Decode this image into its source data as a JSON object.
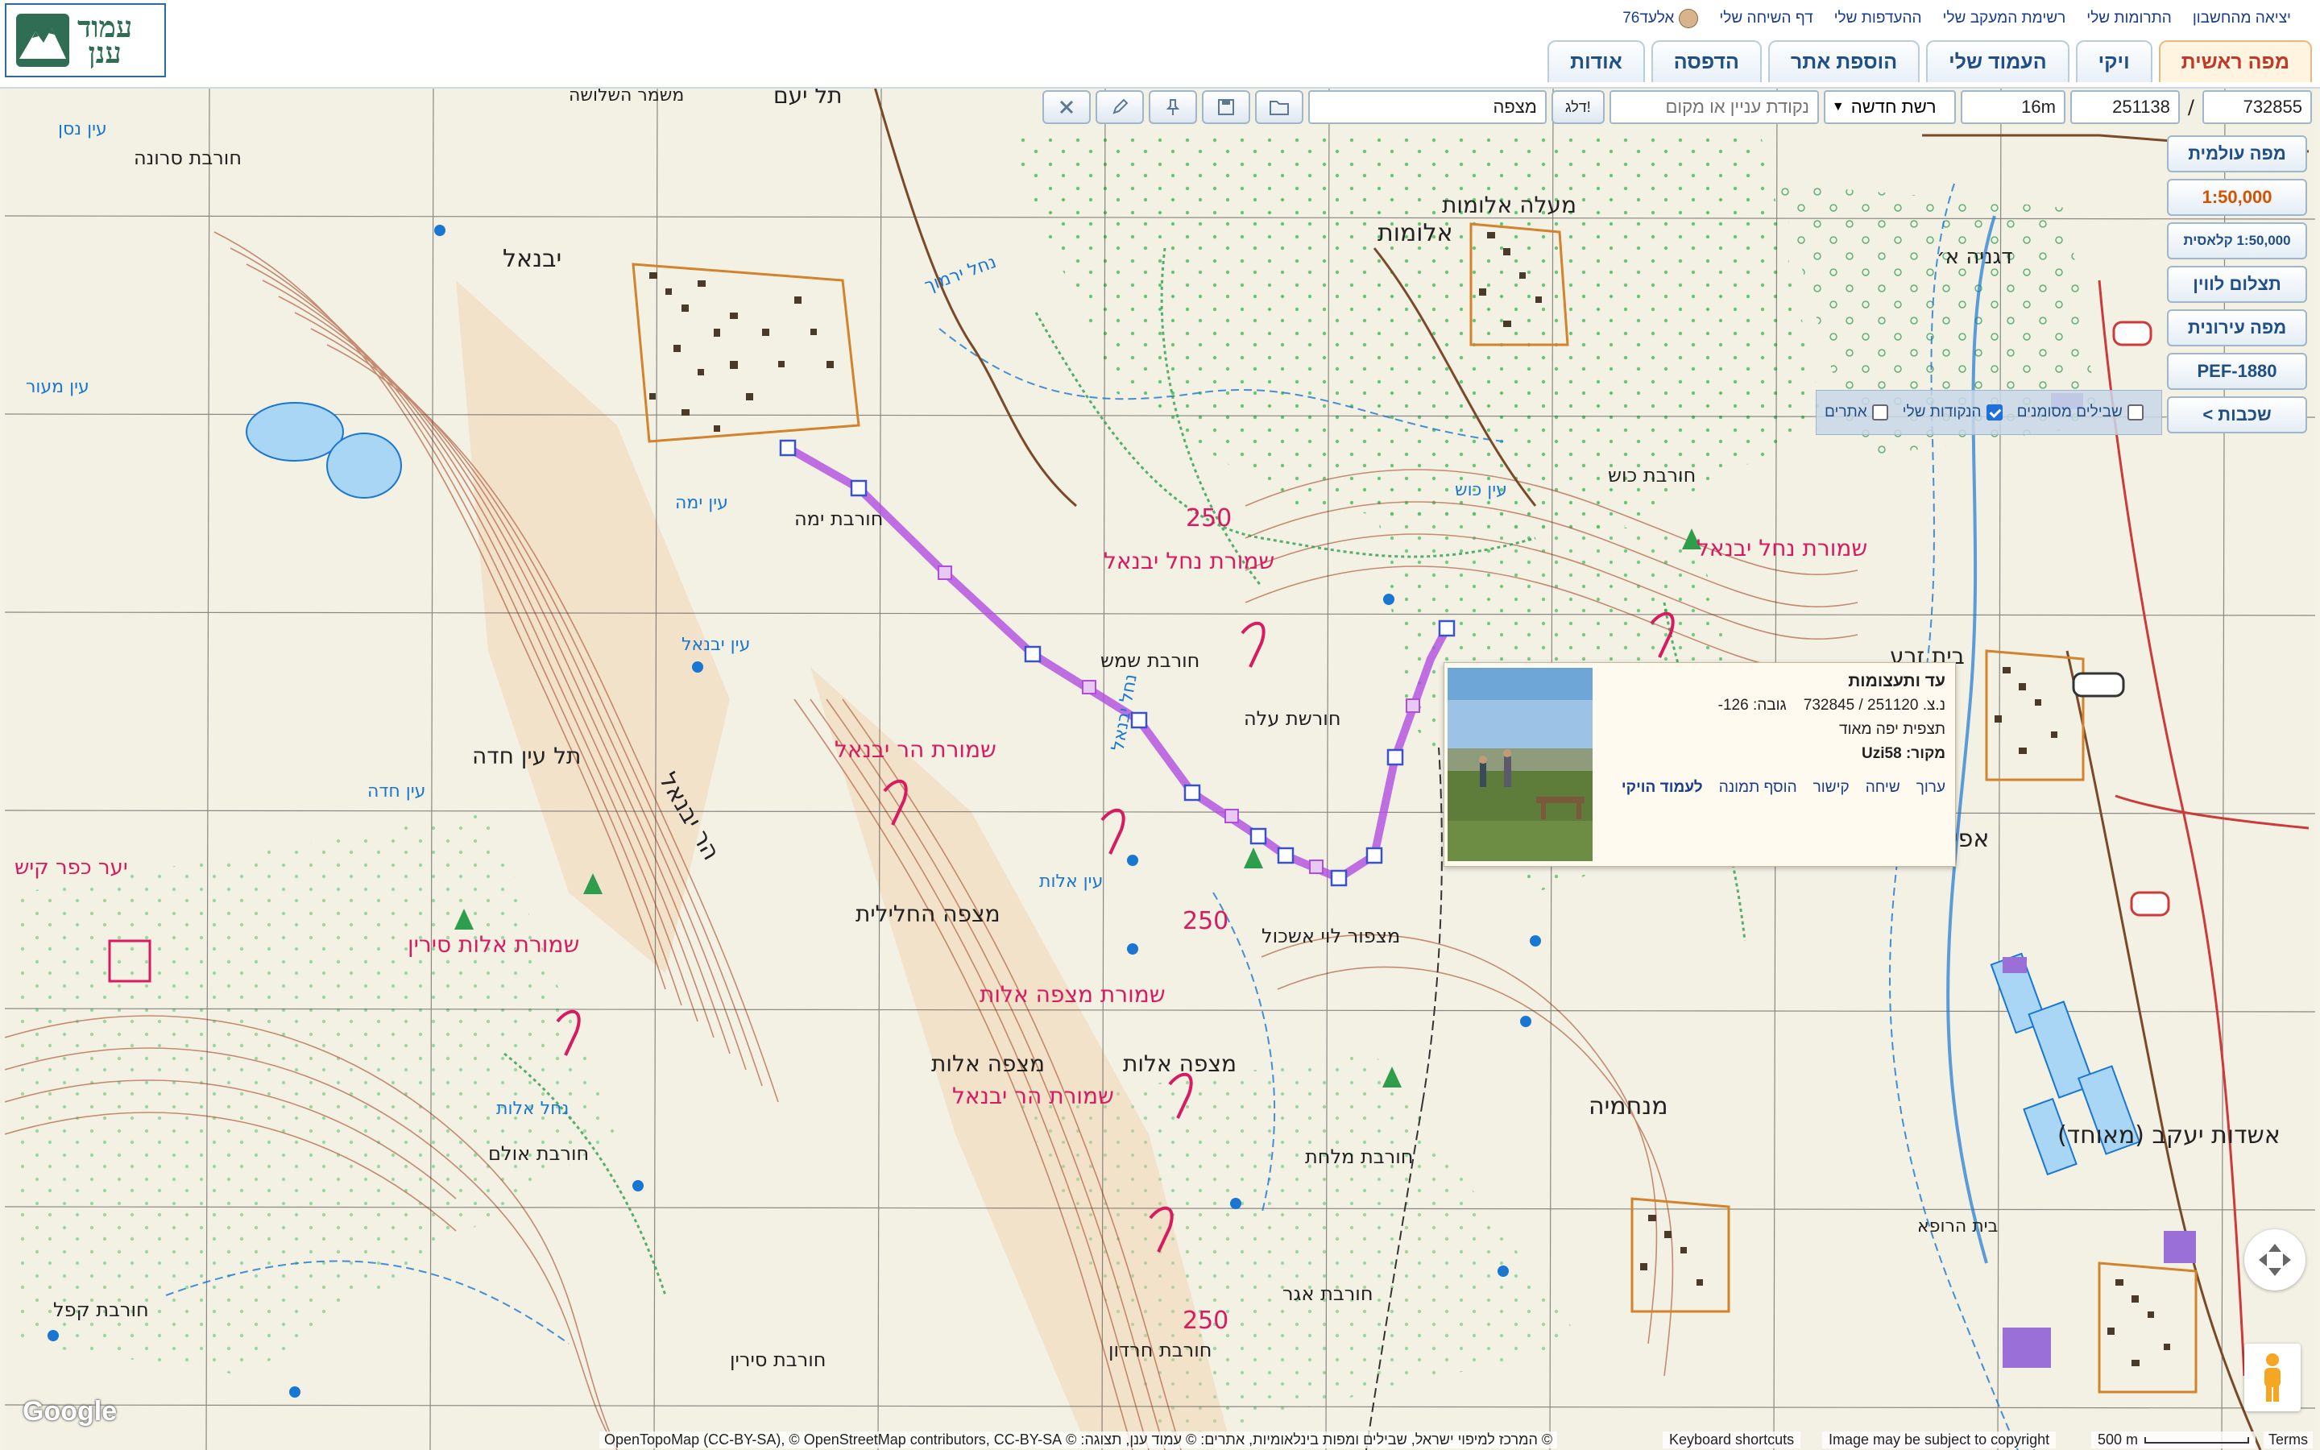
{
  "logo": {
    "text_line1": "עמוד",
    "text_line2": "ענן"
  },
  "user_links": {
    "username": "אלעד76",
    "talk_page": "דף השיחה שלי",
    "preferences": "ההעדפות שלי",
    "watchlist": "רשימת המעקב שלי",
    "contributions": "התרומות שלי",
    "logout": "יציאה מהחשבון"
  },
  "tabs": [
    {
      "label": "מפה ראשית",
      "active": true
    },
    {
      "label": "ויקי"
    },
    {
      "label": "העמוד שלי"
    },
    {
      "label": "הוספת אתר"
    },
    {
      "label": "הדפסה"
    },
    {
      "label": "אודות"
    }
  ],
  "toolbar": {
    "coord_y": "732855",
    "separator": "/",
    "coord_x": "251138",
    "elevation": "16m",
    "grid_select": "רשת חדשה",
    "search_placeholder": "נקודת עניין או מקום",
    "flag_button": "דלג!",
    "search_value": "מצפה"
  },
  "layers": [
    {
      "label": "מפה עולמית"
    },
    {
      "label": "1:50,000",
      "highlight": true
    },
    {
      "label": "1:50,000 קלאסית"
    },
    {
      "label": "תצלום לווין"
    },
    {
      "label": "מפה עירונית"
    },
    {
      "label": "PEF-1880"
    },
    {
      "label": "שכבות >"
    }
  ],
  "overlays": [
    {
      "label": "אתרים",
      "checked": false
    },
    {
      "label": "הנקודות שלי",
      "checked": true
    },
    {
      "label": "שבילים מסומנים",
      "checked": false
    }
  ],
  "popup": {
    "title": "עד ותעצומות",
    "coords_label": "נ.צ.",
    "coords": "251120 / 732845",
    "elevation_label": "גובה:",
    "elevation": "126-",
    "description": "תצפית יפה מאוד",
    "source_label": "מקור:",
    "source": "Uzi58",
    "links": [
      "ערוך",
      "שיחה",
      "קישור",
      "הוסף תמונה",
      "לעמוד הויקי"
    ]
  },
  "map_labels": [
    {
      "text": "שמורת נחל יבנאל",
      "color": "#d81b60"
    },
    {
      "text": "שמורת הר יבנאל",
      "color": "#d81b60"
    },
    {
      "text": "שמורת אלות סירין",
      "color": "#d81b60"
    },
    {
      "text": "שמורת מצפה אלות",
      "color": "#d81b60"
    },
    {
      "text": "שמורת הר יבנאל",
      "color": "#d81b60"
    },
    {
      "text": "שמורת נחל יבנאל",
      "color": "#d81b60"
    },
    {
      "text": "250",
      "color": "#d81b60"
    },
    {
      "text": "250",
      "color": "#d81b60"
    },
    {
      "text": "250",
      "color": "#d81b60"
    },
    {
      "text": "יבנאל",
      "color": "#222"
    },
    {
      "text": "אלומות",
      "color": "#222"
    },
    {
      "text": "מעלה אלומות",
      "color": "#222"
    },
    {
      "text": "מצפה החלילית",
      "color": "#222"
    },
    {
      "text": "מצפה אלות",
      "color": "#222"
    },
    {
      "text": "מצפה אלות",
      "color": "#222"
    },
    {
      "text": "מנחמיה",
      "color": "#222"
    },
    {
      "text": "אשדות יעקב (מאוחד)",
      "color": "#222"
    },
    {
      "text": "אפיקים",
      "color": "#222"
    },
    {
      "text": "בית זרע",
      "color": "#222"
    },
    {
      "text": "חורבת כוש",
      "color": "#222"
    },
    {
      "text": "חורבת שמש",
      "color": "#222"
    },
    {
      "text": "חורשת עלה",
      "color": "#222"
    },
    {
      "text": "חורבת ימה",
      "color": "#222"
    },
    {
      "text": "חורבת סרונה",
      "color": "#222"
    },
    {
      "text": "חורבת קפל",
      "color": "#222"
    },
    {
      "text": "חורבת סירין",
      "color": "#222"
    },
    {
      "text": "חורבת אולם",
      "color": "#222"
    },
    {
      "text": "חורבת מלחת",
      "color": "#222"
    },
    {
      "text": "חורבת חרדון",
      "color": "#222"
    },
    {
      "text": "חורבת אגר",
      "color": "#222"
    },
    {
      "text": "הר יבנאל",
      "color": "#222"
    },
    {
      "text": "תל עין חדה",
      "color": "#222"
    },
    {
      "text": "תל יעם",
      "color": "#222"
    },
    {
      "text": "משמר השלושה",
      "color": "#222"
    },
    {
      "text": "דגניה א׳",
      "color": "#222"
    },
    {
      "text": "בית הרופא",
      "color": "#222"
    },
    {
      "text": "יער כפר קיש",
      "color": "#d81b60"
    },
    {
      "text": "מצפור לוי אשכול",
      "color": "#222"
    },
    {
      "text": "עין אלות",
      "color": "#1976d2"
    },
    {
      "text": "עין חדה",
      "color": "#1976d2"
    },
    {
      "text": "עין יבנאל",
      "color": "#1976d2"
    },
    {
      "text": "עין ימה",
      "color": "#1976d2"
    },
    {
      "text": "עין מעור",
      "color": "#1976d2"
    },
    {
      "text": "עין כוש",
      "color": "#1976d2"
    },
    {
      "text": "נחל יבנאל",
      "color": "#1976d2"
    },
    {
      "text": "נחל ירמוך",
      "color": "#1976d2"
    },
    {
      "text": "נחל אלות",
      "color": "#1976d2"
    },
    {
      "text": "עין נסן",
      "color": "#1976d2"
    }
  ],
  "attribution": {
    "text": "© המרכז למיפוי ישראל, שבילים ומפות בינלאומיות, אתרים: © עמוד ענן, תצוגה: © OpenTopoMap (CC-BY-SA), © OpenStreetMap contributors, CC-BY-SA",
    "keyboard": "Keyboard shortcuts",
    "image_note": "Image may be subject to copyright",
    "scale": "500 m",
    "terms": "Terms",
    "google": "Google"
  },
  "colors": {
    "track": "#b04de0",
    "reserve": "#d81b60",
    "contour": "#b5694a",
    "water": "#1976d2",
    "vegetation": "#2e9e4d"
  }
}
